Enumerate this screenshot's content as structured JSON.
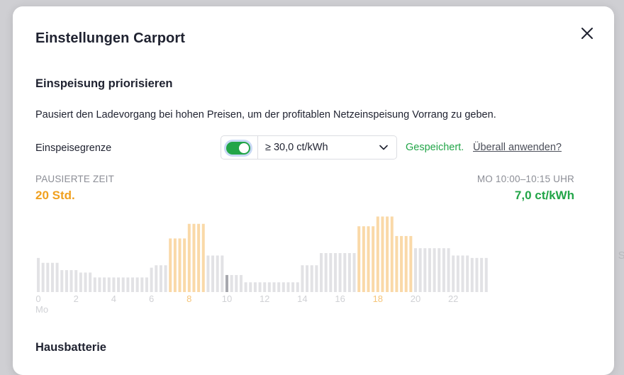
{
  "backdrop": {
    "partial_text": "So"
  },
  "modal": {
    "title": "Einstellungen Carport",
    "close_icon": "close-icon"
  },
  "feed_in": {
    "section_title": "Einspeisung priorisieren",
    "description": "Pausiert den Ladevorgang bei hohen Preisen, um der profitablen Netzeinspeisung Vorrang zu geben.",
    "limit_label": "Einspeisegrenze",
    "toggle_on": true,
    "selected_limit": "≥ 30,0 ct/kWh",
    "saved_text": "Gespeichert.",
    "apply_everywhere_link": "Überall anwenden?"
  },
  "stats": {
    "paused_label": "PAUSIERTE ZEIT",
    "paused_value": "20 Std.",
    "slot_label": "MO 10:00–10:15 UHR",
    "slot_price": "7,0 ct/kWh"
  },
  "colors": {
    "green": "#22a548",
    "orange": "#f0a01e",
    "bar_normal": "#e2e2e5",
    "bar_paused": "#fad9a8",
    "bar_selected": "#a7a8ae",
    "tick_normal": "#d0d1d5",
    "tick_highlight": "#f5c57a"
  },
  "chart_data": {
    "type": "bar",
    "unit": "ct/kWh",
    "day_label": "Mo",
    "x_ticks": [
      "0",
      "2",
      "4",
      "6",
      "8",
      "10",
      "12",
      "14",
      "16",
      "18",
      "20",
      "22"
    ],
    "highlight_ticks": [
      "8",
      "18"
    ],
    "selected_hour": 10,
    "hours": [
      {
        "hour": 0,
        "values": [
          14,
          12,
          12,
          12
        ],
        "paused": [
          false,
          false,
          false,
          false
        ]
      },
      {
        "hour": 1,
        "values": [
          12,
          9,
          9,
          9
        ],
        "paused": [
          false,
          false,
          false,
          false
        ]
      },
      {
        "hour": 2,
        "values": [
          9,
          8,
          8,
          8
        ],
        "paused": [
          false,
          false,
          false,
          false
        ]
      },
      {
        "hour": 3,
        "values": [
          6,
          6,
          6,
          6
        ],
        "paused": [
          false,
          false,
          false,
          false
        ]
      },
      {
        "hour": 4,
        "values": [
          6,
          6,
          6,
          6
        ],
        "paused": [
          false,
          false,
          false,
          false
        ]
      },
      {
        "hour": 5,
        "values": [
          6,
          6,
          6,
          6
        ],
        "paused": [
          false,
          false,
          false,
          false
        ]
      },
      {
        "hour": 6,
        "values": [
          10,
          11,
          11,
          11
        ],
        "paused": [
          false,
          false,
          false,
          false
        ]
      },
      {
        "hour": 7,
        "values": [
          22,
          22,
          22,
          22
        ],
        "paused": [
          true,
          true,
          true,
          true
        ]
      },
      {
        "hour": 8,
        "values": [
          28,
          28,
          28,
          28
        ],
        "paused": [
          true,
          true,
          true,
          true
        ]
      },
      {
        "hour": 9,
        "values": [
          15,
          15,
          15,
          15
        ],
        "paused": [
          false,
          false,
          false,
          false
        ]
      },
      {
        "hour": 10,
        "values": [
          7,
          7,
          7,
          7
        ],
        "paused": [
          false,
          false,
          false,
          false
        ]
      },
      {
        "hour": 11,
        "values": [
          4,
          4,
          4,
          4
        ],
        "paused": [
          false,
          false,
          false,
          false
        ]
      },
      {
        "hour": 12,
        "values": [
          4,
          4,
          4,
          4
        ],
        "paused": [
          false,
          false,
          false,
          false
        ]
      },
      {
        "hour": 13,
        "values": [
          4,
          4,
          4,
          4
        ],
        "paused": [
          false,
          false,
          false,
          false
        ]
      },
      {
        "hour": 14,
        "values": [
          11,
          11,
          11,
          11
        ],
        "paused": [
          false,
          false,
          false,
          false
        ]
      },
      {
        "hour": 15,
        "values": [
          16,
          16,
          16,
          16
        ],
        "paused": [
          false,
          false,
          false,
          false
        ]
      },
      {
        "hour": 16,
        "values": [
          16,
          16,
          16,
          16
        ],
        "paused": [
          false,
          false,
          false,
          false
        ]
      },
      {
        "hour": 17,
        "values": [
          27,
          27,
          27,
          27
        ],
        "paused": [
          true,
          true,
          true,
          true
        ]
      },
      {
        "hour": 18,
        "values": [
          31,
          31,
          31,
          31
        ],
        "paused": [
          true,
          true,
          true,
          true
        ]
      },
      {
        "hour": 19,
        "values": [
          23,
          23,
          23,
          23
        ],
        "paused": [
          true,
          true,
          true,
          true
        ]
      },
      {
        "hour": 20,
        "values": [
          18,
          18,
          18,
          18
        ],
        "paused": [
          false,
          false,
          false,
          false
        ]
      },
      {
        "hour": 21,
        "values": [
          18,
          18,
          18,
          18
        ],
        "paused": [
          false,
          false,
          false,
          false
        ]
      },
      {
        "hour": 22,
        "values": [
          15,
          15,
          15,
          15
        ],
        "paused": [
          false,
          false,
          false,
          false
        ]
      },
      {
        "hour": 23,
        "values": [
          14,
          14,
          14,
          14
        ],
        "paused": [
          false,
          false,
          false,
          false
        ]
      }
    ]
  },
  "next_section": {
    "title": "Hausbatterie"
  }
}
